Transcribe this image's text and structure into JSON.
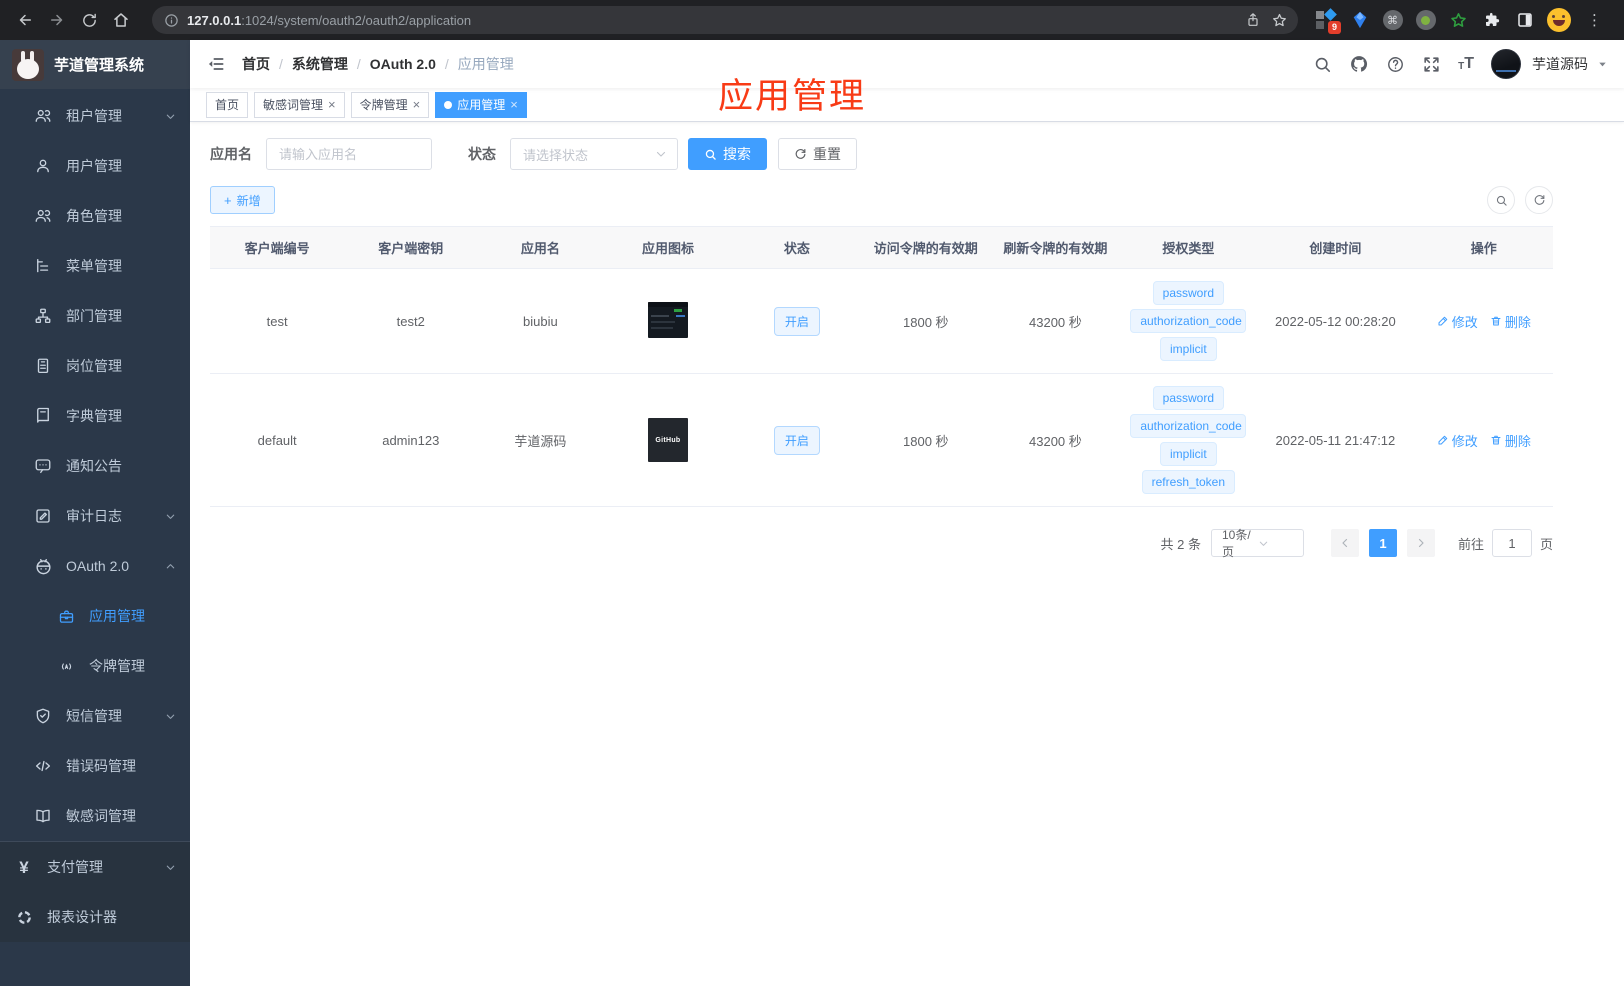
{
  "browser": {
    "url_host": "127.0.0.1",
    "url_path": ":1024/system/oauth2/oauth2/application",
    "extension_badge": "9"
  },
  "sidebar": {
    "title": "芋道管理系统",
    "items": [
      {
        "label": "租户管理"
      },
      {
        "label": "用户管理"
      },
      {
        "label": "角色管理"
      },
      {
        "label": "菜单管理"
      },
      {
        "label": "部门管理"
      },
      {
        "label": "岗位管理"
      },
      {
        "label": "字典管理"
      },
      {
        "label": "通知公告"
      },
      {
        "label": "审计日志"
      },
      {
        "label": "OAuth 2.0"
      },
      {
        "label": "应用管理"
      },
      {
        "label": "令牌管理"
      },
      {
        "label": "短信管理"
      },
      {
        "label": "错误码管理"
      },
      {
        "label": "敏感词管理"
      },
      {
        "label": "支付管理"
      },
      {
        "label": "报表设计器"
      }
    ]
  },
  "header": {
    "breadcrumb": [
      {
        "label": "首页"
      },
      {
        "label": "系统管理"
      },
      {
        "label": "OAuth 2.0"
      },
      {
        "label": "应用管理"
      }
    ],
    "username": "芋道源码"
  },
  "tags": [
    {
      "label": "首页"
    },
    {
      "label": "敏感词管理"
    },
    {
      "label": "令牌管理"
    },
    {
      "label": "应用管理"
    }
  ],
  "annotation": {
    "text": "应用管理"
  },
  "filters": {
    "app_name_label": "应用名",
    "app_name_placeholder": "请输入应用名",
    "status_label": "状态",
    "status_placeholder": "请选择状态",
    "search_label": "搜索",
    "reset_label": "重置",
    "add_label": "新增"
  },
  "table": {
    "headers": [
      "客户端编号",
      "客户端密钥",
      "应用名",
      "应用图标",
      "状态",
      "访问令牌的有效期",
      "刷新令牌的有效期",
      "授权类型",
      "创建时间",
      "操作"
    ],
    "rows": [
      {
        "client_id": "test",
        "client_secret": "test2",
        "app_name": "biubiu",
        "status": "开启",
        "access_token_validity": "1800 秒",
        "refresh_token_validity": "43200 秒",
        "grant_types": [
          "password",
          "authorization_code",
          "implicit"
        ],
        "create_time": "2022-05-12 00:28:20",
        "edit_label": "修改",
        "delete_label": "删除"
      },
      {
        "client_id": "default",
        "client_secret": "admin123",
        "app_name": "芋道源码",
        "icon_text": "GitHub",
        "status": "开启",
        "access_token_validity": "1800 秒",
        "refresh_token_validity": "43200 秒",
        "grant_types": [
          "password",
          "authorization_code",
          "implicit",
          "refresh_token"
        ],
        "create_time": "2022-05-11 21:47:12",
        "edit_label": "修改",
        "delete_label": "删除"
      }
    ]
  },
  "pagination": {
    "total": "共 2 条",
    "page_size": "10条/页",
    "current_page": "1",
    "goto_label": "前往",
    "goto_value": "1",
    "page_unit": "页"
  },
  "colors": {
    "accent": "#409eff",
    "annotation_red": "#f83b16",
    "sidebar_bg": "#2b3849"
  }
}
